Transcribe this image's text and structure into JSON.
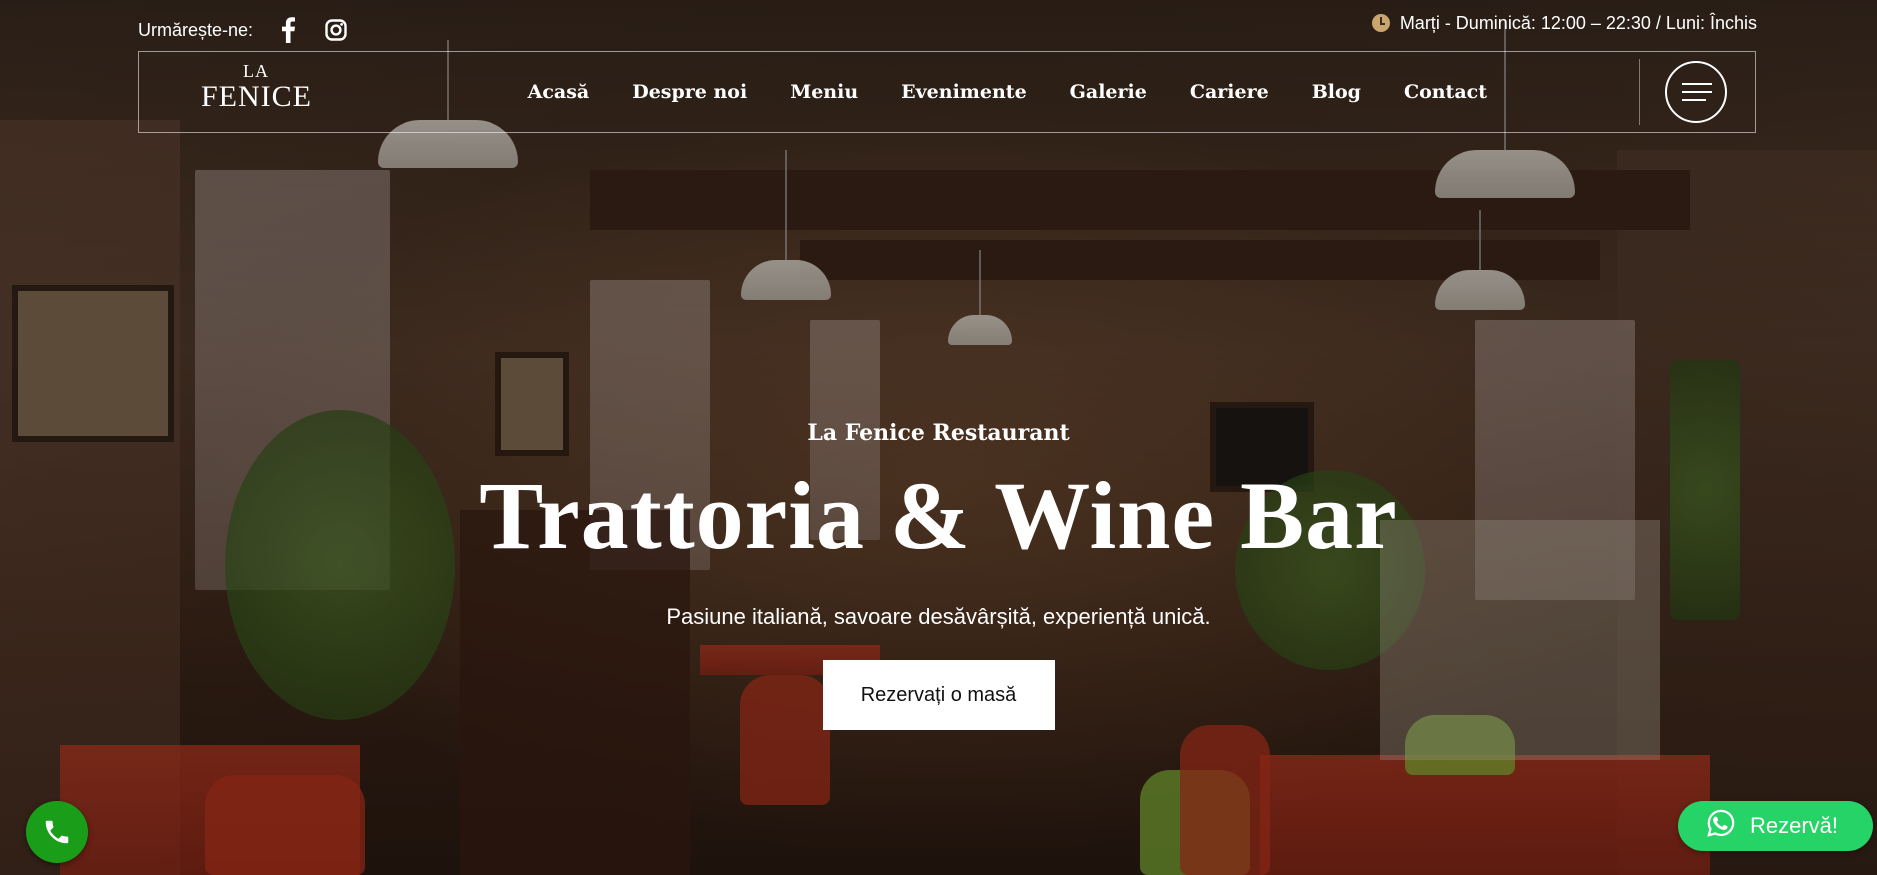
{
  "topbar": {
    "follow_label": "Urmărește-ne:",
    "social": [
      {
        "icon": "facebook-icon"
      },
      {
        "icon": "instagram-icon"
      }
    ],
    "hours_icon": "clock-icon",
    "hours_text": "Marți - Duminică: 12:00 – 22:30 / Luni: Închis"
  },
  "header": {
    "logo_top": "LA",
    "logo_bottom": "FENICE",
    "nav": [
      {
        "label": "Acasă"
      },
      {
        "label": "Despre noi"
      },
      {
        "label": "Meniu"
      },
      {
        "label": "Evenimente"
      },
      {
        "label": "Galerie"
      },
      {
        "label": "Cariere"
      },
      {
        "label": "Blog"
      },
      {
        "label": "Contact"
      }
    ],
    "menu_icon": "hamburger-menu-icon"
  },
  "hero": {
    "eyebrow": "La Fenice Restaurant",
    "headline": "Trattoria & Wine Bar",
    "tagline": "Pasiune italiană, savoare desăvârșită, experiență unică.",
    "cta_label": "Rezervați o masă"
  },
  "floating": {
    "call_icon": "phone-icon",
    "whatsapp_icon": "whatsapp-icon",
    "whatsapp_label": "Rezervă!"
  },
  "colors": {
    "accent_gold": "#c8a66d",
    "call_green": "#1a9e1a",
    "whatsapp_green": "#25d366"
  }
}
